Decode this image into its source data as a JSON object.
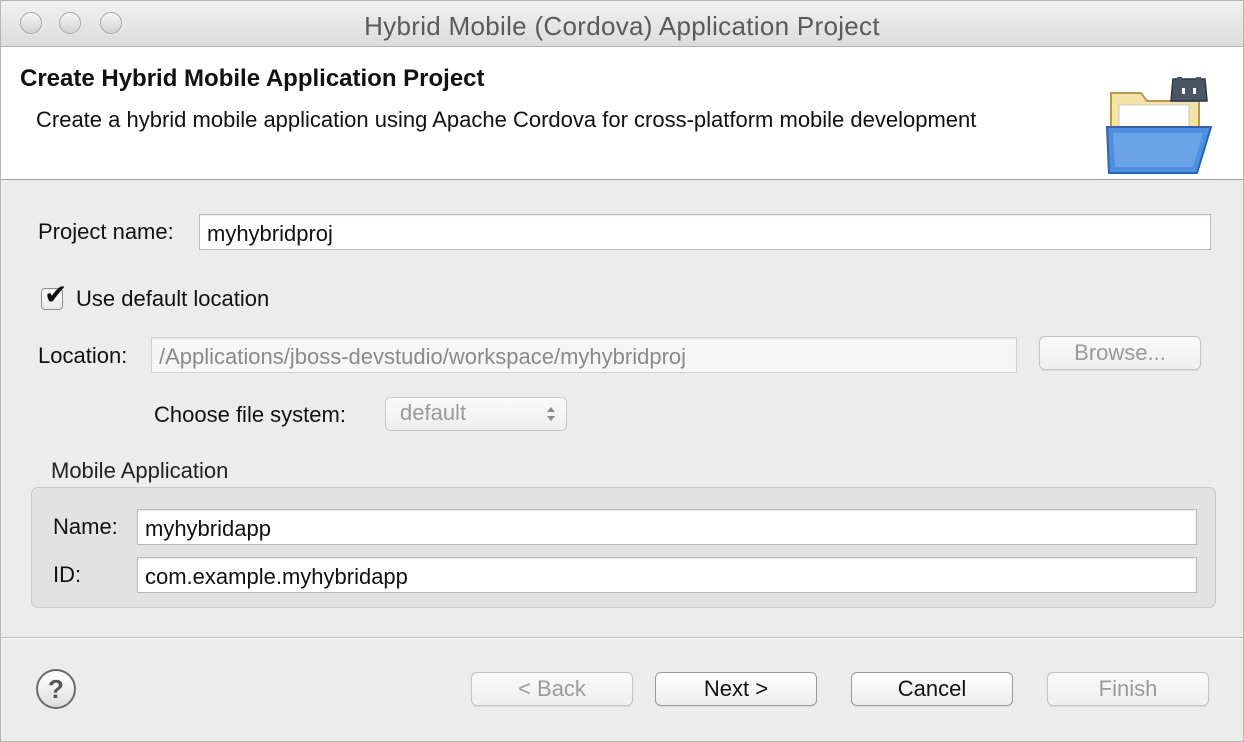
{
  "window": {
    "title": "Hybrid Mobile (Cordova) Application Project"
  },
  "banner": {
    "title": "Create Hybrid Mobile Application Project",
    "description": "Create a hybrid mobile application using Apache Cordova for cross-platform mobile development",
    "icon": "folder-cordova-icon"
  },
  "form": {
    "project_name_label": "Project name:",
    "project_name_value": "myhybridproj",
    "use_default_location_label": "Use default location",
    "use_default_location_checked": true,
    "location_label": "Location:",
    "location_value": "/Applications/jboss-devstudio/workspace/myhybridproj",
    "browse_label": "Browse...",
    "file_system_label": "Choose file system:",
    "file_system_value": "default"
  },
  "mobile_app": {
    "group_title": "Mobile Application",
    "name_label": "Name:",
    "name_value": "myhybridapp",
    "id_label": "ID:",
    "id_value": "com.example.myhybridapp"
  },
  "footer": {
    "help_icon": "question-mark-icon",
    "help_glyph": "?",
    "back_label": "< Back",
    "next_label": "Next >",
    "cancel_label": "Cancel",
    "finish_label": "Finish"
  },
  "colors": {
    "window_bg": "#ececec",
    "banner_bg": "#ffffff",
    "folder_blue": "#4f8fe0"
  }
}
